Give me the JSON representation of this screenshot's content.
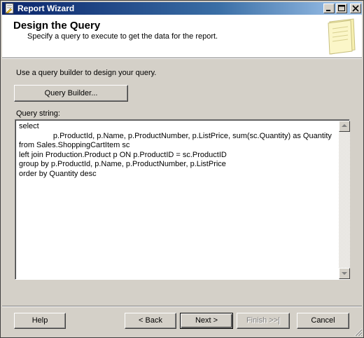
{
  "window": {
    "title": "Report Wizard"
  },
  "header": {
    "title": "Design the Query",
    "subtitle": "Specify a query to execute to get the data for the report."
  },
  "main": {
    "instruction": "Use a query builder to design your query.",
    "query_builder_label": "Query Builder...",
    "query_string_label": "Query string:",
    "query_text": "select\n                p.ProductId, p.Name, p.ProductNumber, p.ListPrice, sum(sc.Quantity) as Quantity\nfrom Sales.ShoppingCartItem sc\nleft join Production.Product p ON p.ProductID = sc.ProductID\ngroup by p.ProductId, p.Name, p.ProductNumber, p.ListPrice\norder by Quantity desc"
  },
  "footer": {
    "help_label": "Help",
    "back_label": "< Back",
    "next_label": "Next >",
    "finish_label": "Finish >>|",
    "cancel_label": "Cancel"
  },
  "colors": {
    "title_bar_start": "#0a246a",
    "title_bar_end": "#a6caf0",
    "dialog_face": "#d4d0c8"
  }
}
